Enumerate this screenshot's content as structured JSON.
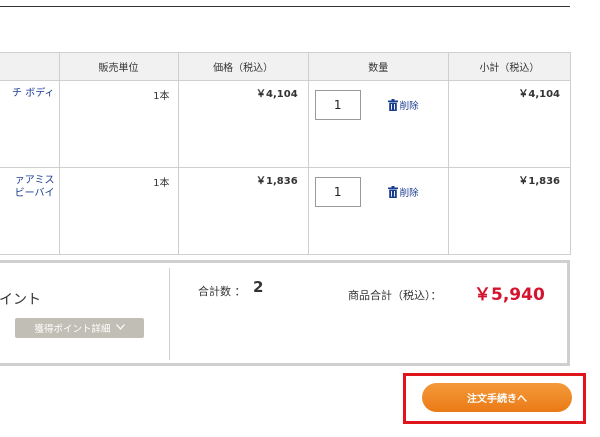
{
  "table": {
    "headers": {
      "unit": "販売単位",
      "price": "価格（税込）",
      "qty": "数量",
      "subtotal": "小計（税込）"
    },
    "rows": [
      {
        "name_line1": "チ ボディ",
        "name_line2": "",
        "unit": "1本",
        "price": "￥4,104",
        "qty": "1",
        "delete_label": "削除",
        "subtotal": "￥4,104"
      },
      {
        "name_line1": "ァアミス",
        "name_line2": "ビーバイ",
        "unit": "1本",
        "price": "￥1,836",
        "qty": "1",
        "delete_label": "削除",
        "subtotal": "￥1,836"
      }
    ]
  },
  "summary": {
    "points_title": "イント",
    "points_detail_button": "獲得ポイント詳細",
    "count_label": "合計数 ：",
    "count_value": "2",
    "total_label": "商品合計（税込）：",
    "total_value": "￥5,940",
    "total_color": "#d4142e"
  },
  "checkout": {
    "button_label": "注文手続きへ",
    "highlight_color": "#e0141b",
    "button_color": "#f08a28"
  },
  "icons": {
    "delete": "trash-icon",
    "points_toggle": "chevron-down-icon"
  }
}
